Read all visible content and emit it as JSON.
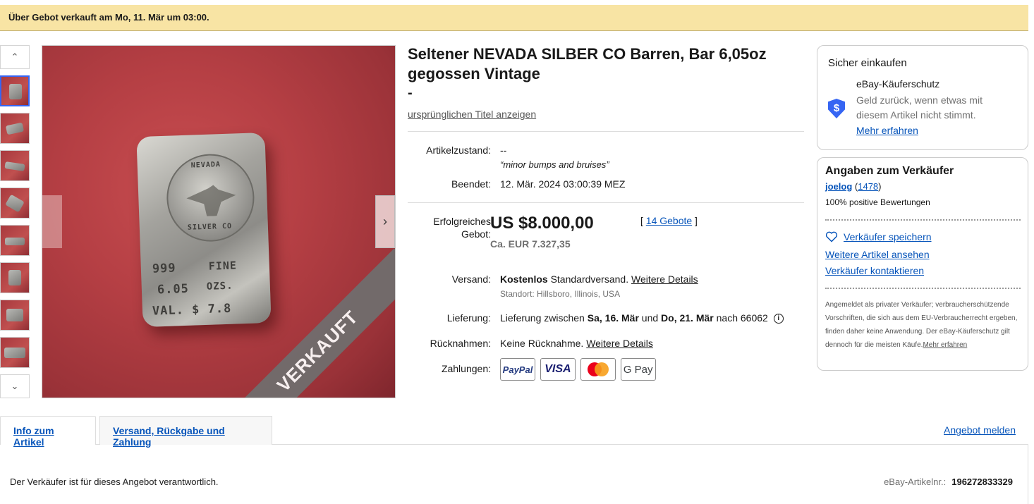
{
  "banner": {
    "text": "Über Gebot verkauft am Mo, 11. Mär um 03:00."
  },
  "gallery": {
    "overlay_label": "VERKAUFT",
    "stamps": [
      "NEVADA",
      "SILVER CO",
      "999",
      "FINE",
      "6.05",
      "OZS.",
      "VAL. $ 7.8"
    ]
  },
  "item": {
    "title": "Seltener NEVADA SILBER CO Barren, Bar 6,05oz gegossen Vintage",
    "title_dash": "-",
    "original_title_link": "ursprünglichen Titel anzeigen",
    "condition_label": "Artikelzustand:",
    "condition_value": "--",
    "condition_note": "minor bumps and bruises",
    "ended_label": "Beendet:",
    "ended_value": "12. Mär. 2024 03:00:39 MEZ",
    "winning_bid_label": "Erfolgreiches Gebot:",
    "price": "US $8.000,00",
    "price_approx": "Ca. EUR 7.327,35",
    "bids_link": "14 Gebote",
    "shipping_label": "Versand:",
    "shipping_free": "Kostenlos",
    "shipping_type": "Standardversand.",
    "shipping_details_link": "Weitere Details",
    "location": "Standort: Hillsboro, Illinois, USA",
    "delivery_label": "Lieferung:",
    "delivery_prefix": "Lieferung zwischen",
    "delivery_from": "Sa, 16. Mär",
    "delivery_and": "und",
    "delivery_to": "Do, 21. Mär",
    "delivery_suffix": "nach 66062",
    "returns_label": "Rücknahmen:",
    "returns_value": "Keine Rücknahme.",
    "returns_details_link": "Weitere Details",
    "payments_label": "Zahlungen:",
    "payment_methods": [
      "PayPal",
      "VISA",
      "Mastercard",
      "G Pay"
    ]
  },
  "safe_shopping": {
    "heading": "Sicher einkaufen",
    "protection_title": "eBay-Käuferschutz",
    "protection_text": "Geld zurück, wenn etwas mit diesem Artikel nicht stimmt.",
    "more_link": "Mehr erfahren"
  },
  "seller": {
    "heading": "Angaben zum Verkäufer",
    "name": "joelog",
    "feedback_count": "1478",
    "positive": "100% positive Bewertungen",
    "save_seller": "Verkäufer speichern",
    "more_items": "Weitere Artikel ansehen",
    "contact": "Verkäufer kontaktieren",
    "private_note": "Angemeldet als privater Verkäufer; verbraucherschützende Vorschriften, die sich aus dem EU-Verbraucherrecht ergeben, finden daher keine Anwendung. Der eBay-Käuferschutz gilt dennoch für die meisten Käufe.",
    "private_note_link": "Mehr erfahren"
  },
  "tabs": {
    "info": "Info zum Artikel",
    "shipping": "Versand, Rückgabe und Zahlung",
    "report": "Angebot melden"
  },
  "footer": {
    "responsibility": "Der Verkäufer ist für dieses Angebot verantwortlich.",
    "item_number_label": "eBay-Artikelnr.:",
    "item_number": "196272833329"
  }
}
